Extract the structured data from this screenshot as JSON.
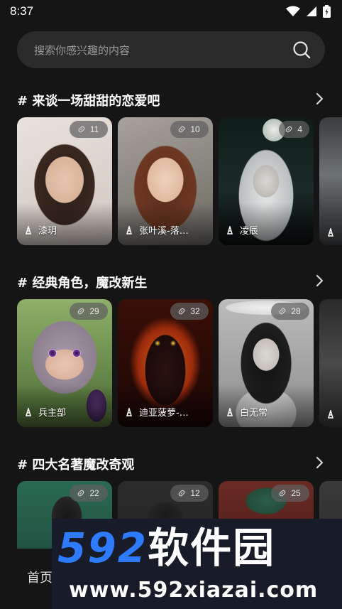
{
  "status": {
    "time": "8:37"
  },
  "search": {
    "placeholder": "搜索你感兴趣的内容"
  },
  "sections": [
    {
      "title": "# 来谈一场甜甜的恋爱吧",
      "cards": [
        {
          "name": "漆玥",
          "count": "11"
        },
        {
          "name": "张叶溪-落…",
          "count": "10"
        },
        {
          "name": "凌辰",
          "count": "4"
        },
        {
          "name": "",
          "count": ""
        }
      ]
    },
    {
      "title": "# 经典角色，魔改新生",
      "cards": [
        {
          "name": "兵主部",
          "count": "29"
        },
        {
          "name": "迪亚菠萝-…",
          "count": "32"
        },
        {
          "name": "白无常",
          "count": "28"
        },
        {
          "name": "",
          "count": ""
        }
      ]
    },
    {
      "title": "# 四大名著魔改奇观",
      "cards": [
        {
          "name": "",
          "count": "22"
        },
        {
          "name": "",
          "count": "12"
        },
        {
          "name": "",
          "count": "25"
        },
        {
          "name": "",
          "count": ""
        }
      ]
    }
  ],
  "bottom_nav": {
    "home": "首页"
  },
  "watermark": {
    "brand_num": "592",
    "brand_cn": "软件园",
    "url": "www.592xiazai.com"
  },
  "colors": {
    "background": "#151515",
    "search_bg": "#2b2b2b",
    "badge_bg": "#5f5f5f",
    "watermark_blue": "#2f7bff"
  }
}
